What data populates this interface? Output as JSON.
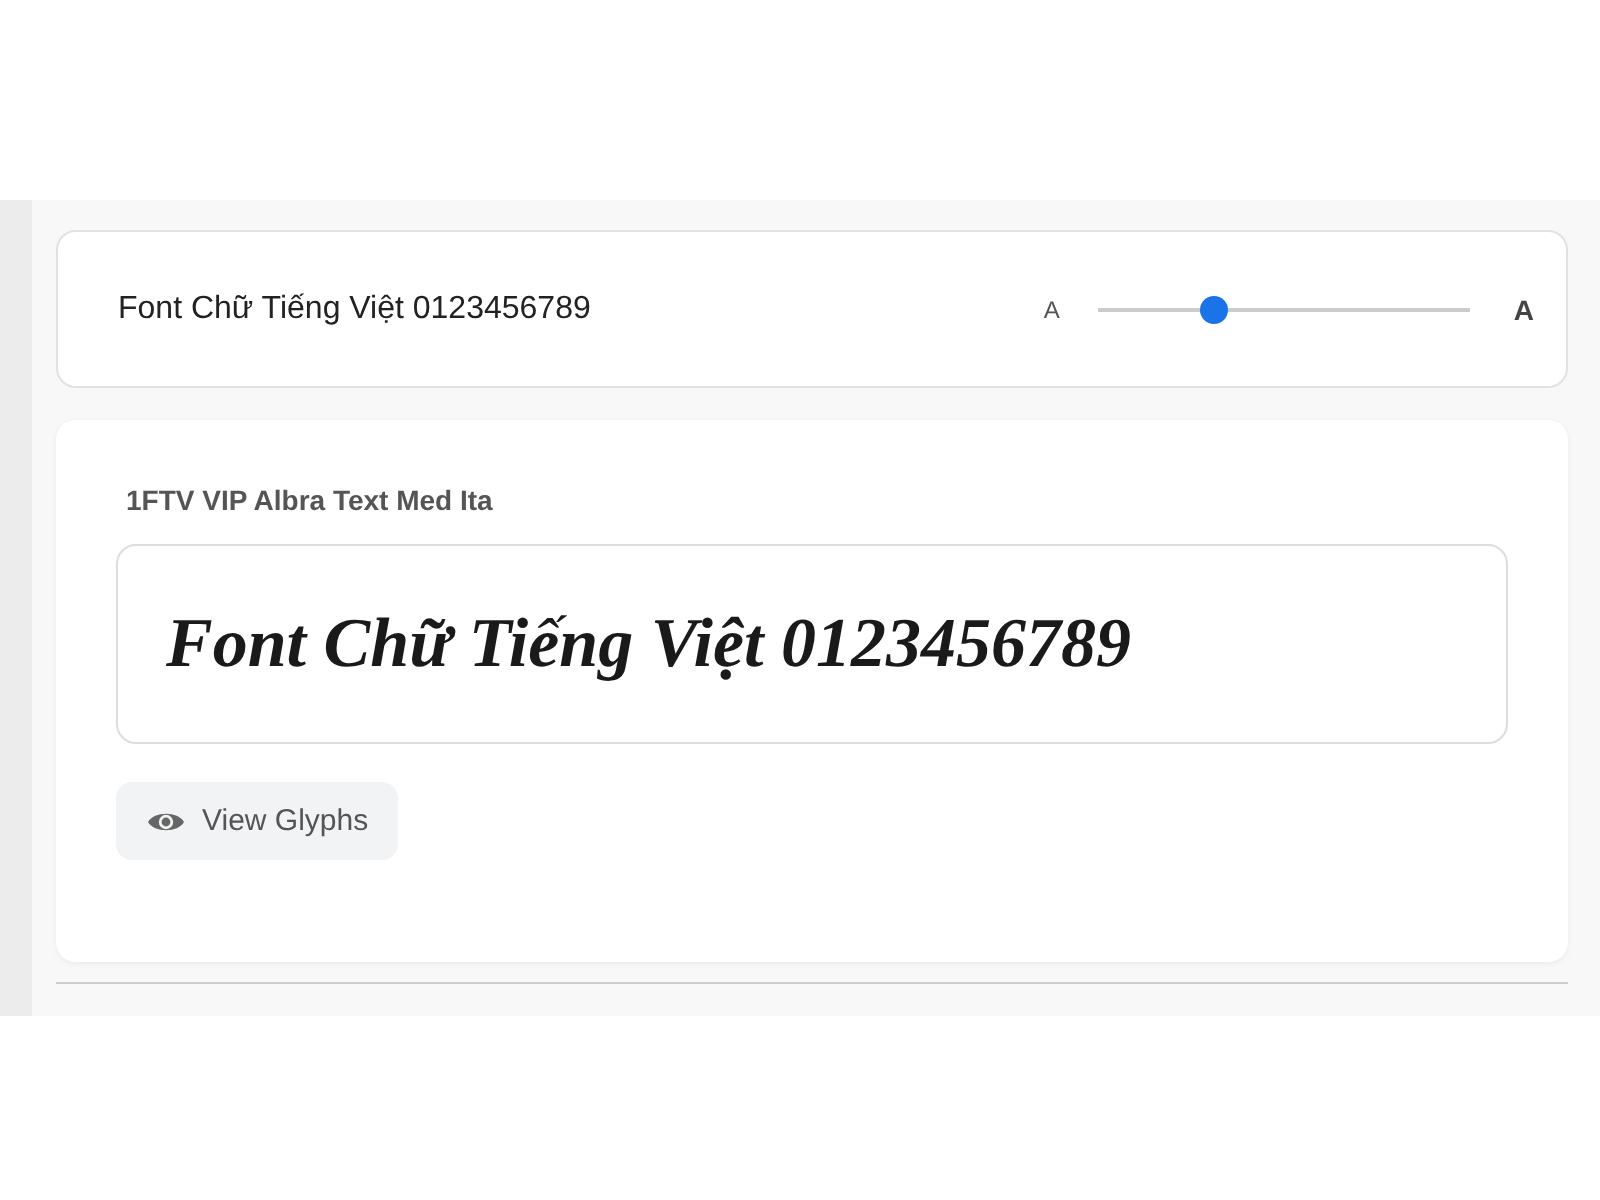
{
  "preview_bar": {
    "sample_text": "Font Chữ Tiếng Việt 0123456789",
    "size_small_label": "A",
    "size_large_label": "A",
    "size_slider": {
      "level": 0.31
    }
  },
  "font_card": {
    "font_name": "1FTV VIP Albra Text Med Ita",
    "preview_text": "Font Chữ Tiếng Việt 0123456789",
    "view_button": "View Glyphs"
  }
}
